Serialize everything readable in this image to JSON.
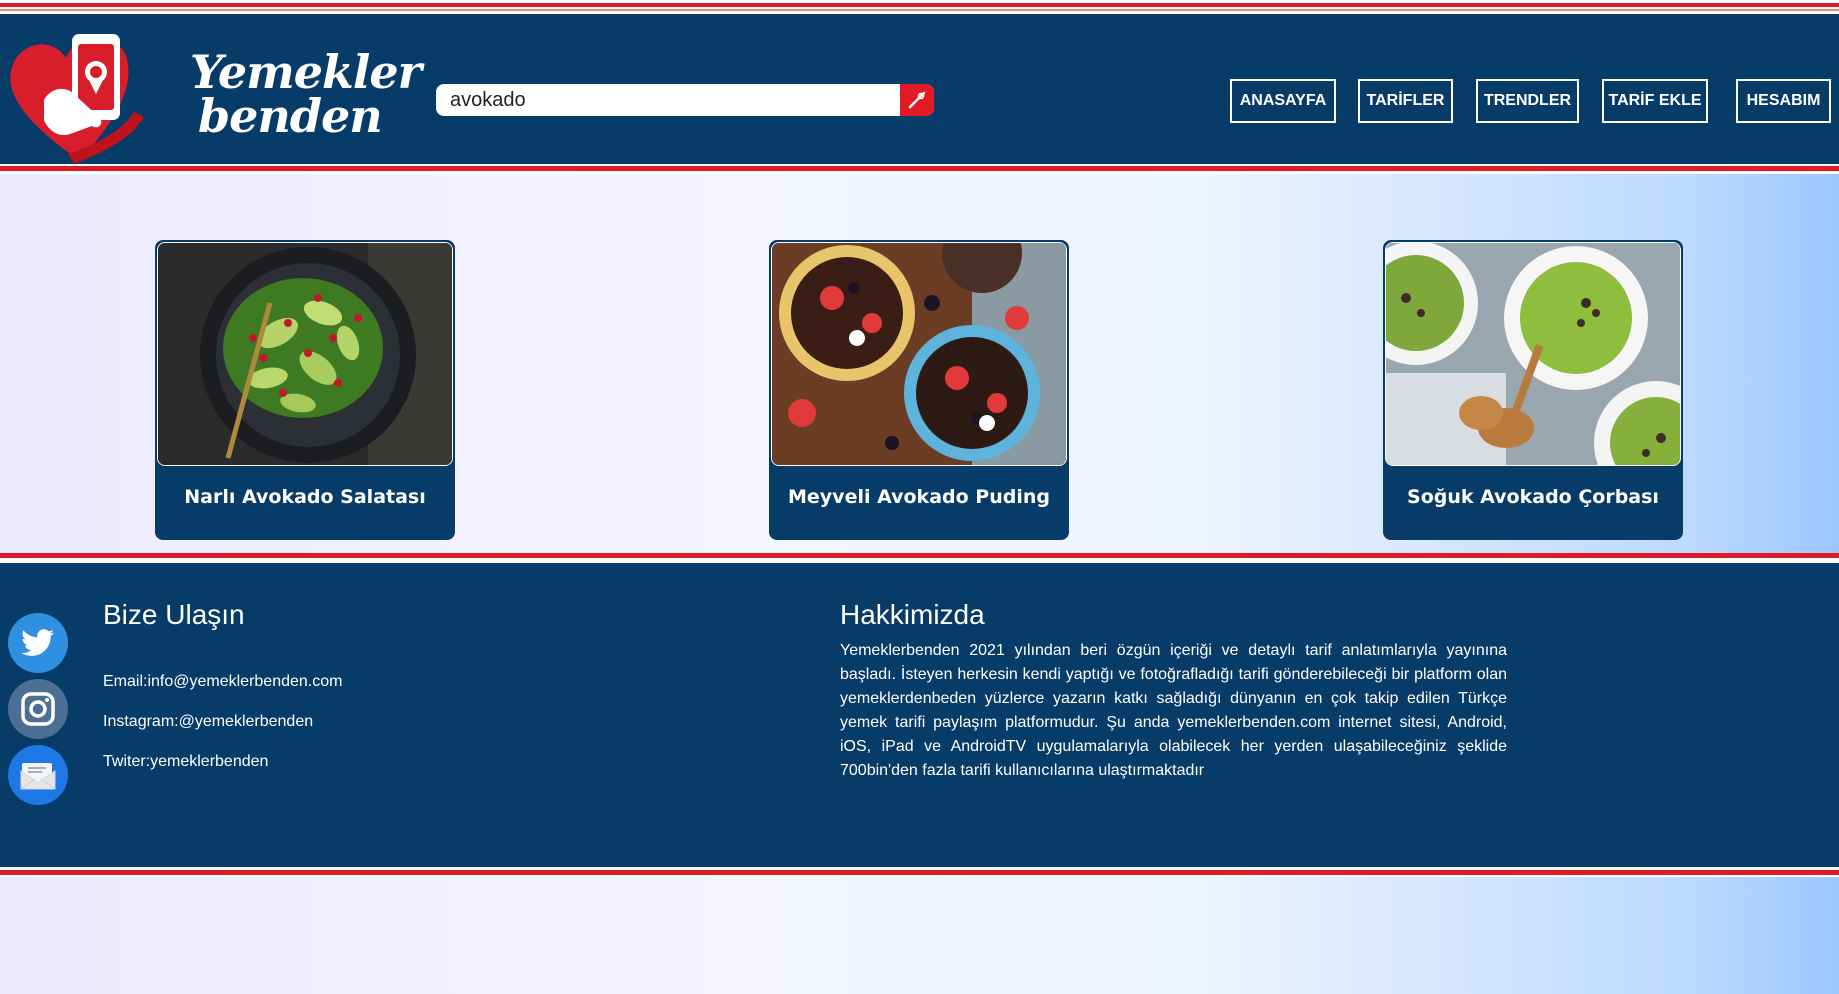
{
  "brand": {
    "line1": "Yemekler",
    "line2": "benden"
  },
  "search": {
    "value": "avokado",
    "placeholder": ""
  },
  "nav": [
    {
      "label": "ANASAYFA"
    },
    {
      "label": "TARİFLER"
    },
    {
      "label": "TRENDLER"
    },
    {
      "label": "TARİF EKLE"
    },
    {
      "label": "HESABIM"
    }
  ],
  "recipes": [
    {
      "title": "Narlı Avokado Salatası",
      "image": "avocado-salad-photo"
    },
    {
      "title": "Meyveli Avokado Puding",
      "image": "avocado-pudding-photo"
    },
    {
      "title": "Soğuk Avokado Çorbası",
      "image": "cold-avocado-soup-photo"
    }
  ],
  "footer": {
    "contact_title": "Bize Ulaşın",
    "email": "Email:info@yemeklerbenden.com",
    "instagram": "Instagram:@yemeklerbenden",
    "twitter": "Twiter:yemeklerbenden",
    "about_title": "Hakkimizda",
    "about_text": "Yemeklerbenden 2021 yılından beri özgün içeriği ve detaylı tarif anlatımlarıyla yayınına başladı. İsteyen herkesin kendi yaptığı ve fotoğrafladığı tarifi gönderebileceği bir platform olan yemeklerdenbeden yüzlerce yazarın katkı sağladığı dünyanın en çok takip edilen Türkçe yemek tarifi paylaşım platformudur. Şu anda yemeklerbenden.com internet sitesi, Android, iOS, iPad ve AndroidTV uygulamalarıyla olabilecek her yerden ulaşabileceğiniz şeklide 700bin'den fazla tarifi kullanıcılarına ulaştırmaktadır",
    "social_icons": [
      "twitter-icon",
      "instagram-icon",
      "mail-icon"
    ]
  },
  "colors": {
    "header_bg": "#073b68",
    "accent_red": "#e11b25",
    "twitter_blue": "#2f8fe0",
    "instagram_bg": "#4e6f94",
    "mail_blue": "#1e78e6"
  }
}
